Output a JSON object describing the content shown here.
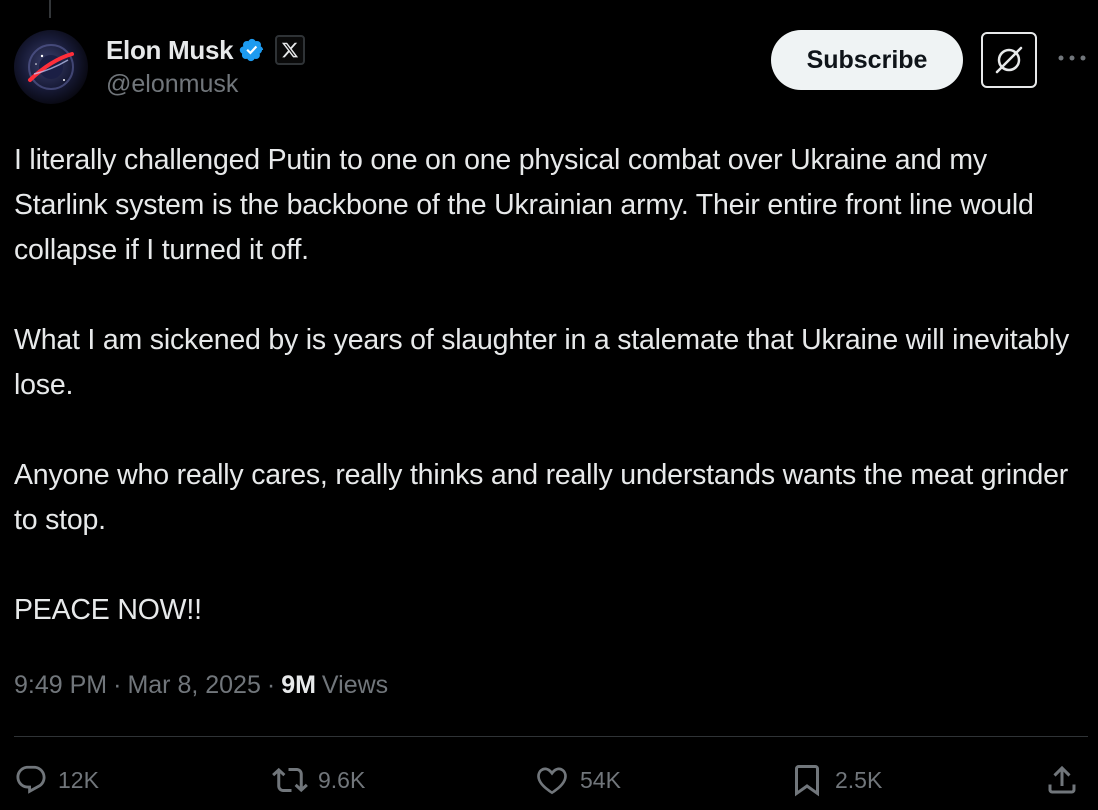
{
  "author": {
    "display_name": "Elon Musk",
    "handle": "@elonmusk",
    "avatar_icon": "galaxy-avatar-icon",
    "verified_icon": "verified-badge-icon",
    "affiliation_icon": "x-logo-icon"
  },
  "header_actions": {
    "subscribe_label": "Subscribe",
    "grok_icon": "grok-slash-icon",
    "more_icon": "more-dots-icon"
  },
  "tweet": {
    "paragraphs": [
      "I literally challenged Putin to one on one physical combat over Ukraine and my Starlink system is the backbone of the Ukrainian army. Their entire front line would collapse if I turned it off.",
      "What I am sickened by is years of slaughter in a stalemate that Ukraine will inevitably lose.",
      "Anyone who really cares, really thinks and really understands wants the meat grinder to stop.",
      "PEACE NOW!!"
    ]
  },
  "meta": {
    "time": "9:49 PM",
    "separator": "·",
    "date": "Mar 8, 2025",
    "views_count": "9M",
    "views_label": "Views"
  },
  "engagement": {
    "replies": "12K",
    "reposts": "9.6K",
    "likes": "54K",
    "bookmarks": "2.5K",
    "share_icon": "share-icon"
  },
  "colors": {
    "background": "#000000",
    "text_primary": "#e7e9ea",
    "text_secondary": "#71767b",
    "verified_blue": "#1d9bf0",
    "divider": "#2f3336",
    "subscribe_bg": "#eff3f4"
  }
}
